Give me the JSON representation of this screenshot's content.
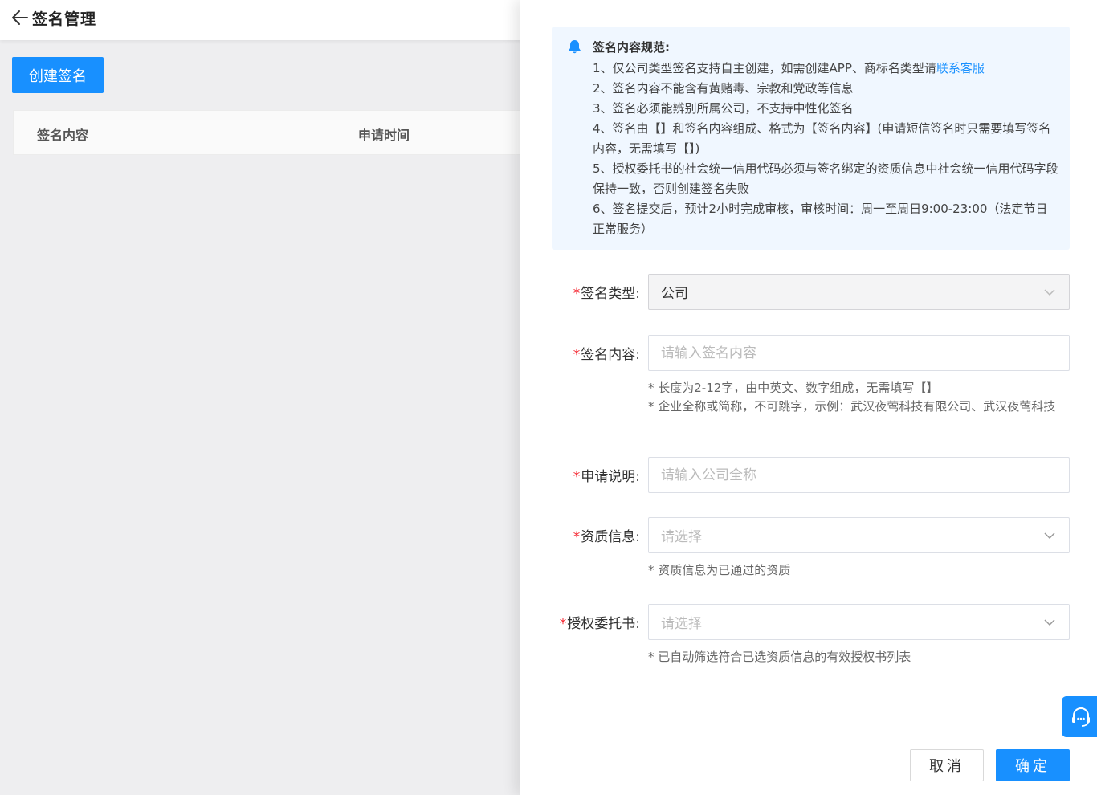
{
  "header": {
    "title": "签名管理"
  },
  "toolbar": {
    "create_label": "创建签名"
  },
  "table": {
    "columns": [
      "签名内容",
      "申请时间"
    ]
  },
  "notice": {
    "title": "签名内容规范:",
    "line1_prefix": "1、仅公司类型签名支持自主创建，如需创建APP、商标名类型请",
    "line1_link": "联系客服",
    "line2": "2、签名内容不能含有黄赌毒、宗教和党政等信息",
    "line3": "3、签名必须能辨别所属公司，不支持中性化签名",
    "line4": "4、签名由【】和签名内容组成、格式为【签名内容】(申请短信签名时只需要填写签名内容，无需填写【】)",
    "line5": "5、授权委托书的社会统一信用代码必须与签名绑定的资质信息中社会统一信用代码字段保持一致，否则创建签名失败",
    "line6": "6、签名提交后，预计2小时完成审核，审核时间：周一至周日9:00-23:00（法定节日正常服务）"
  },
  "form": {
    "required_mark": "*",
    "sig_type": {
      "label": "签名类型:",
      "value": "公司"
    },
    "sig_content": {
      "label": "签名内容:",
      "placeholder": "请输入签名内容",
      "hint1": "* 长度为2-12字，由中英文、数字组成，无需填写【】",
      "hint2": "* 企业全称或简称，不可跳字，示例：武汉夜莺科技有限公司、武汉夜莺科技"
    },
    "apply_desc": {
      "label": "申请说明:",
      "placeholder": "请输入公司全称"
    },
    "qualification": {
      "label": "资质信息:",
      "placeholder": "请选择",
      "hint": "* 资质信息为已通过的资质"
    },
    "authorization": {
      "label": "授权委托书:",
      "placeholder": "请选择",
      "hint": "* 已自动筛选符合已选资质信息的有效授权书列表"
    }
  },
  "footer": {
    "cancel_label": "取消",
    "ok_label": "确定"
  },
  "colors": {
    "primary": "#1890ff",
    "required": "#f5222d",
    "notice_bg": "#f0f7ff"
  }
}
